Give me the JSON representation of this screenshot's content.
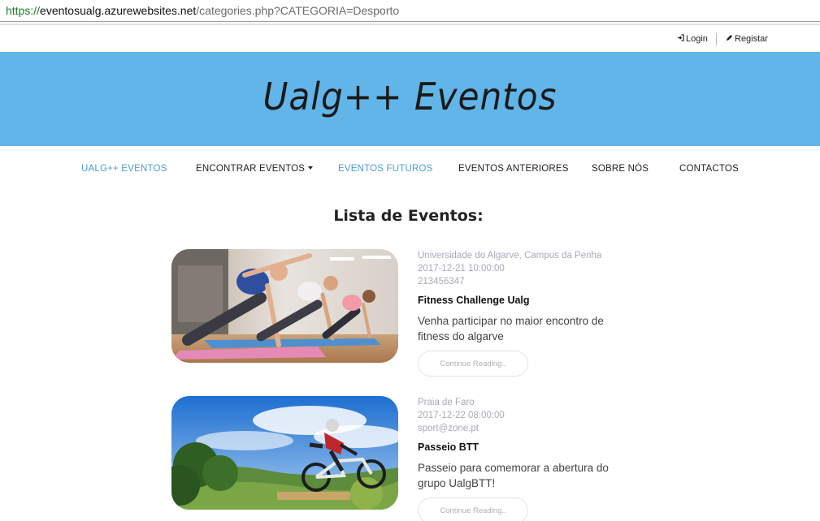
{
  "browser": {
    "url_scheme": "https://",
    "url_host": "eventosualg.azurewebsites.net",
    "url_path": "/categories.php?CATEGORIA=Desporto"
  },
  "topbar": {
    "login_label": "Login",
    "register_label": "Registar"
  },
  "header": {
    "title": "Ualg++ Eventos"
  },
  "nav": {
    "items": [
      {
        "label": "UALG++ EVENTOS"
      },
      {
        "label": "ENCONTRAR EVENTOS"
      },
      {
        "label": "EVENTOS FUTUROS"
      },
      {
        "label": "EVENTOS ANTERIORES"
      },
      {
        "label": "SOBRE NÓS"
      },
      {
        "label": "CONTACTOS"
      }
    ]
  },
  "main": {
    "heading": "Lista de Eventos:",
    "events": [
      {
        "location": "Universidade do Algarve, Campus da Penha",
        "datetime": "2017-12-21 10:00:00",
        "contact": "213456347",
        "title": "Fitness Challenge Ualg",
        "description": "Venha participar no maior encontro de fitness do algarve",
        "button": "Continue Reading..",
        "image": "fitness-class-photo"
      },
      {
        "location": "Praia de Faro",
        "datetime": "2017-12-22 08:00:00",
        "contact": "sport@zone.pt",
        "title": "Passeio BTT",
        "description": "Passeio para comemorar a abertura do grupo UalgBTT!",
        "button": "Continue Reading..",
        "image": "mountain-bike-photo"
      }
    ]
  },
  "colors": {
    "banner": "#62b5e8",
    "nav_active": "#4e9bd1",
    "meta_text": "#a9a9b6"
  }
}
